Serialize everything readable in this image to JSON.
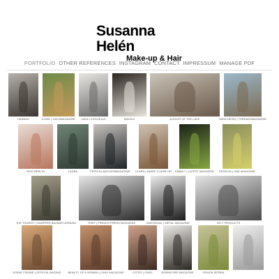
{
  "header": {
    "name": "Susanna Helén",
    "subtitle": "Make-up & Hair"
  },
  "nav": {
    "items": [
      {
        "label": "PORTFOLIO",
        "active": true
      },
      {
        "label": "OTHER REFERENCES"
      },
      {
        "label": "INSTAGRAM"
      },
      {
        "label": "CONTACT"
      },
      {
        "label": "IMPRESSUM"
      },
      {
        "label": "MANAGE PDF"
      }
    ]
  },
  "gallery": [
    {
      "caption": "HANNAH",
      "colors": [
        "#b5b0aa",
        "#3a3530"
      ]
    },
    {
      "caption": "ELINE | GULDMAGAZINE",
      "colors": [
        "#6c8a4a",
        "#c39a5a"
      ]
    },
    {
      "caption": "JADA | VOGUEscD",
      "colors": [
        "#e8e6e2",
        "#6a6a6a"
      ]
    },
    {
      "caption": "MAGALI",
      "colors": [
        "#2a2420",
        "#e8e4dc"
      ]
    },
    {
      "caption": "AUGUST AT THE LAKE",
      "colors": [
        "#c9c3b8",
        "#6a5848"
      ]
    },
    {
      "caption": "SARA NEVIN | THREADSMAGAZINE",
      "colors": [
        "#9db9cc",
        "#7a6a52"
      ]
    },
    {
      "caption": "KEIO BERLIN",
      "colors": [
        "#e8dcd4",
        "#b8765e"
      ]
    },
    {
      "caption": "LAURA",
      "colors": [
        "#6f8676",
        "#2e3a32"
      ]
    },
    {
      "caption": "PRISCILLA|SCHONMAGAZINE",
      "colors": [
        "#c6c2bd",
        "#1e2226"
      ]
    },
    {
      "caption": "CLARA | MARIE CLAIRE HR",
      "colors": [
        "#cfc1b2",
        "#7a5636"
      ]
    },
    {
      "caption": "EMMA T | LATEST MAGAZINE",
      "colors": [
        "#1b2318",
        "#86a642"
      ]
    },
    {
      "caption": "PASSION | ONE MAGAZINE",
      "colors": [
        "#8a8e5e",
        "#d5cf6a"
      ]
    },
    {
      "caption": "THE TOURIST | HARPERS BAZAAR UKRAINE",
      "colors": [
        "#a4a08c",
        "#3a3a30"
      ]
    },
    {
      "caption": "TOBY | FRENCH PRESS MAGAZINE",
      "colors": [
        "#e6e6e6",
        "#2a2a2a"
      ]
    },
    {
      "caption": "INDIVIDUAL | METAL MAGAZINE",
      "colors": [
        "#eaeaea",
        "#1c1c1c"
      ]
    },
    {
      "caption": "VELT PRODUCTS",
      "colors": [
        "#e4e4e4",
        "#4a4a4a"
      ]
    },
    {
      "caption": "DIVINE FEMINE | OFFICIAL BAZAAR",
      "colors": [
        "#d9a978",
        "#6a4830"
      ]
    },
    {
      "caption": "BEAUTY OF A WOMAN | CAKE MAGAZINE",
      "colors": [
        "#c4926c",
        "#5a3a2a"
      ]
    },
    {
      "caption": "COTES | CINEL",
      "colors": [
        "#cfa48a",
        "#3c2a22"
      ]
    },
    {
      "caption": "NORMCORE MAGAZINE",
      "colors": [
        "#eeece8",
        "#2a2622"
      ]
    },
    {
      "caption": "GRAZIA SERBIA",
      "colors": [
        "#c8c39a",
        "#7a8a3a"
      ]
    },
    {
      "caption": "",
      "colors": [
        "#eeeeee",
        "#9a9a9a"
      ]
    }
  ]
}
